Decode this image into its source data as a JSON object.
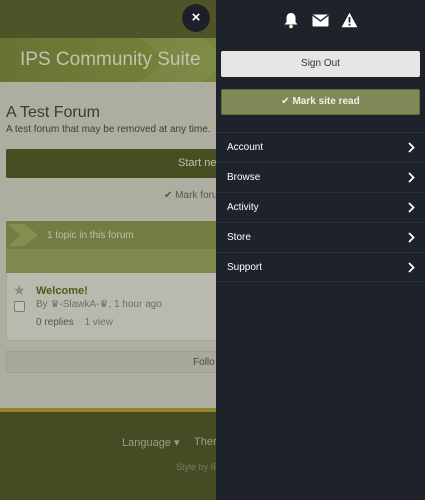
{
  "background": {
    "site_title": "IPS Community Suite",
    "forum": {
      "title": "A Test Forum",
      "description": "A test forum that may be removed at any time.",
      "start_button_label": "Start ne",
      "mark_forum_label": "Mark foru"
    },
    "topics": {
      "count_label": "1 topic in this forum",
      "items": [
        {
          "title": "Welcome!",
          "meta": "By ♛-SlawkA-♛, 1 hour ago",
          "replies": "0 replies",
          "views": "1 view"
        }
      ]
    },
    "follow_label": "Follo",
    "footer": {
      "language_label": "Language ▾",
      "theme_label": "Ther",
      "style_label": "Style by IP"
    }
  },
  "close_button": {
    "label": "×",
    "icon": "close-icon"
  },
  "drawer": {
    "icons": [
      "bell-icon",
      "envelope-icon",
      "warning-icon"
    ],
    "sign_out_label": "Sign Out",
    "mark_read_label": "Mark site read",
    "menu": [
      {
        "label": "Account"
      },
      {
        "label": "Browse"
      },
      {
        "label": "Activity"
      },
      {
        "label": "Store"
      },
      {
        "label": "Support"
      }
    ]
  },
  "colors": {
    "drawer_bg": "#1d222b",
    "accent_olive": "#7f8958",
    "header_green": "#889b3d"
  }
}
